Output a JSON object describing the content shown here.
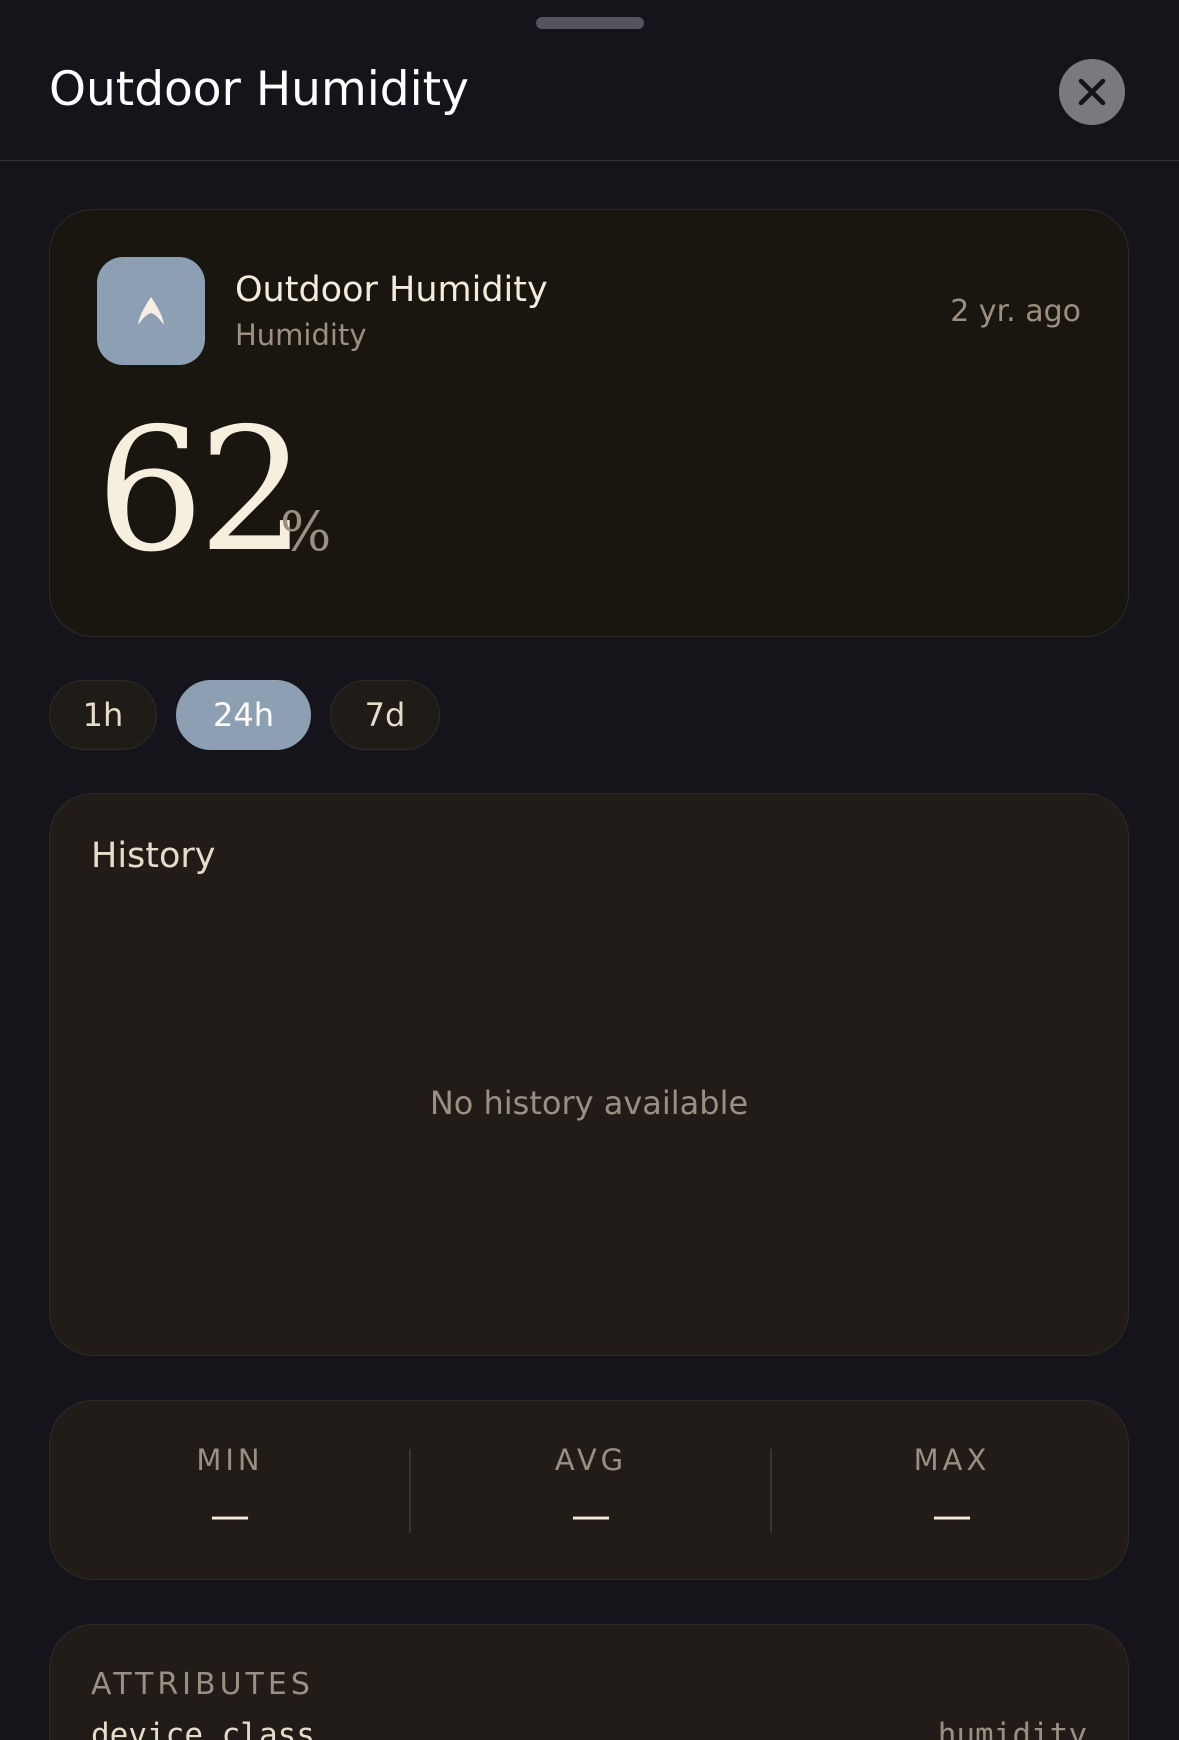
{
  "header": {
    "title": "Outdoor Humidity",
    "close_icon": "close-icon"
  },
  "entity": {
    "icon": "humidity-icon",
    "accent_color": "#8d9fb3",
    "name": "Outdoor Humidity",
    "type": "Humidity",
    "last_changed": "2 yr. ago",
    "value": "62",
    "unit": "%"
  },
  "range_tabs": [
    {
      "label": "1h",
      "active": false
    },
    {
      "label": "24h",
      "active": true
    },
    {
      "label": "7d",
      "active": false
    }
  ],
  "history": {
    "title": "History",
    "empty_message": "No history available"
  },
  "stats": [
    {
      "label": "MIN",
      "value": "—"
    },
    {
      "label": "AVG",
      "value": "—"
    },
    {
      "label": "MAX",
      "value": "—"
    }
  ],
  "attributes": {
    "title": "ATTRIBUTES",
    "items": [
      {
        "key": "device_class",
        "value": "humidity"
      }
    ]
  }
}
